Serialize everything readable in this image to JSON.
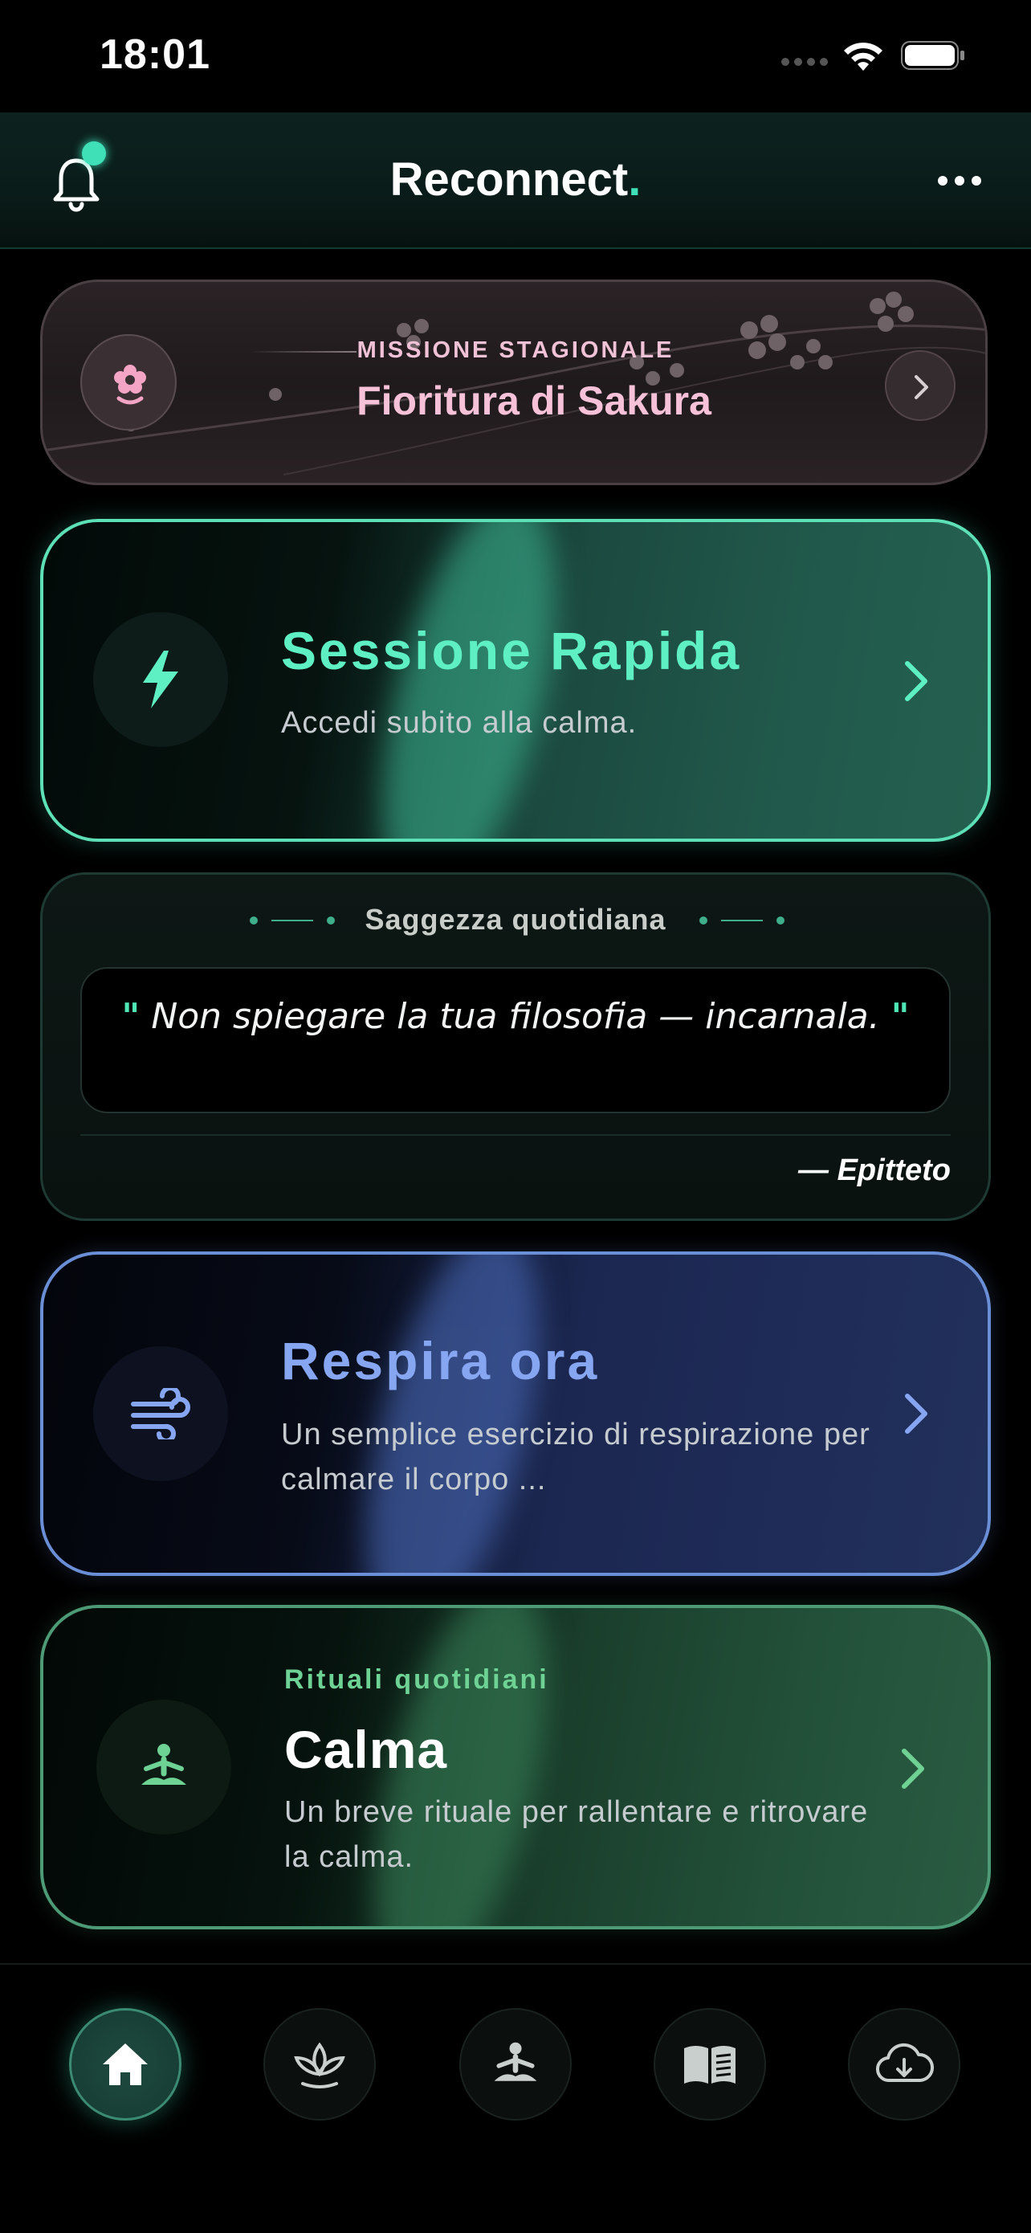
{
  "status_bar": {
    "time": "18:01"
  },
  "header": {
    "title": "Reconnect",
    "title_suffix": "."
  },
  "mission": {
    "kicker": "MISSIONE STAGIONALE",
    "title": "Fioritura di Sakura"
  },
  "quick_session": {
    "title": "Sessione Rapida",
    "subtitle": "Accedi subito alla calma."
  },
  "wisdom": {
    "heading": "Saggezza quotidiana",
    "quote": "Non spiegare la tua filosofia — incarnala.",
    "open_quote": "\"",
    "close_quote": "\"",
    "author": "— Epitteto"
  },
  "breathe": {
    "title": "Respira ora",
    "subtitle": "Un semplice esercizio di respirazione per calmare il corpo ..."
  },
  "ritual": {
    "kicker": "Rituali quotidiani",
    "title": "Calma",
    "subtitle": "Un breve rituale per rallentare e ritrovare la calma."
  },
  "tabs": [
    {
      "icon": "home-icon"
    },
    {
      "icon": "plant-icon"
    },
    {
      "icon": "meditation-icon"
    },
    {
      "icon": "book-icon"
    },
    {
      "icon": "cloud-download-icon"
    }
  ],
  "colors": {
    "accent_teal": "#3fe0b8",
    "quick_border": "#5ee0b6",
    "breath_accent": "#87a6f2",
    "ritual_accent": "#6ed294",
    "sakura_pink": "#f7c2d8"
  }
}
